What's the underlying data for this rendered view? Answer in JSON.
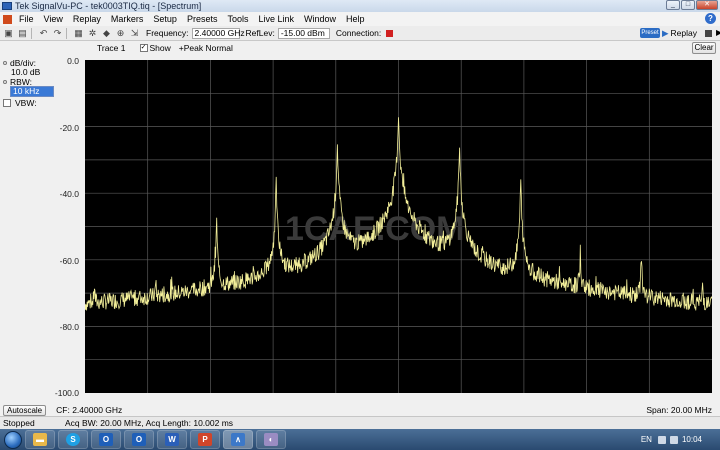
{
  "window": {
    "title": "Tek SignalVu-PC - tek0003TIQ.tiq - [Spectrum]",
    "minimize": "_",
    "maximize": "□",
    "close": "✕"
  },
  "menu": {
    "items": [
      "File",
      "View",
      "Replay",
      "Markers",
      "Setup",
      "Presets",
      "Tools",
      "Live Link",
      "Window",
      "Help"
    ],
    "help_icon": "?"
  },
  "toolbar": {
    "icons": [
      "save-icon",
      "open-icon",
      "undo-icon",
      "redo-icon",
      "print-icon",
      "settings-icon",
      "marker-icon",
      "zoom-icon",
      "cursor-icon"
    ],
    "frequency_label": "Frequency:",
    "frequency_value": "2.40000 GHz",
    "reflev_label": "RefLev:",
    "reflev_value": "-15.00 dBm",
    "connection_label": "Connection:",
    "connection_color": "#d12020",
    "preset_label": "Preset",
    "replay_label": "Replay"
  },
  "left_panel": {
    "dbdiv_label": "dB/div:",
    "dbdiv_value": "10.0 dB",
    "rbw_label": "RBW:",
    "rbw_value": "10 kHz",
    "vbw_label": "VBW:"
  },
  "trace_bar": {
    "trace_label": "Trace 1",
    "show_label": "Show",
    "show_checked": true,
    "detection_label": "+Peak Normal",
    "clear_label": "Clear"
  },
  "chart_data": {
    "type": "line",
    "y_ticks": [
      "0.0",
      "-20.0",
      "-40.0",
      "-60.0",
      "-80.0",
      "-100.0"
    ],
    "ylim": [
      -100,
      0
    ],
    "grid": true,
    "trace_color": "#f3ef9a",
    "background": "#000000",
    "watermark": "1CAE.COM",
    "x_span_mhz": [
      -10,
      10
    ],
    "peaks": [
      {
        "x": -9.7,
        "y": -69.5
      },
      {
        "x": -7.75,
        "y": -71.0
      },
      {
        "x": -5.8,
        "y": -49.0
      },
      {
        "x": -3.9,
        "y": -37.5
      },
      {
        "x": -1.95,
        "y": -25.5
      },
      {
        "x": 0.0,
        "y": -16.0
      },
      {
        "x": 1.95,
        "y": -26.5
      },
      {
        "x": 3.9,
        "y": -37.5
      },
      {
        "x": 5.8,
        "y": -58.0
      },
      {
        "x": 7.75,
        "y": -58.5
      },
      {
        "x": 9.7,
        "y": -68.5
      }
    ],
    "noise_floor": -94.0
  },
  "bottom_bar": {
    "autoscale_label": "Autoscale",
    "cf_text": "CF: 2.40000 GHz",
    "span_text": "Span: 20.00 MHz"
  },
  "status_bar": {
    "status": "Stopped",
    "acq_text": "Acq BW: 20.00 MHz, Acq Length: 10.002 ms"
  },
  "taskbar": {
    "apps": [
      {
        "name": "explorer",
        "glyph": "▬",
        "color": "#e8b84a"
      },
      {
        "name": "skype",
        "glyph": "S",
        "color": "#1fa0e3"
      },
      {
        "name": "outlook-1",
        "glyph": "O",
        "color": "#1f5fb8"
      },
      {
        "name": "outlook-2",
        "glyph": "O",
        "color": "#1f5fb8"
      },
      {
        "name": "word",
        "glyph": "W",
        "color": "#2b5fb8"
      },
      {
        "name": "powerpoint",
        "glyph": "P",
        "color": "#d0452a"
      },
      {
        "name": "signalvu",
        "glyph": "∧",
        "color": "#3c78c8"
      },
      {
        "name": "paint",
        "glyph": "◐",
        "color": "#9a8cc2"
      }
    ],
    "lang": "EN",
    "clock": "10:04"
  }
}
